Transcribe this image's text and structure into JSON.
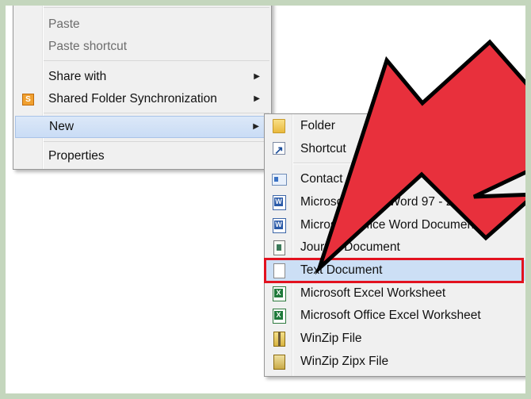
{
  "context_menu": {
    "items": [
      {
        "label": "Paste",
        "disabled": true
      },
      {
        "label": "Paste shortcut",
        "disabled": true
      },
      {
        "label": "Share with",
        "has_submenu": true
      },
      {
        "label": "Shared Folder Synchronization",
        "has_submenu": true,
        "icon": "sync-icon",
        "icon_glyph": "S"
      },
      {
        "label": "New",
        "has_submenu": true,
        "selected": true
      },
      {
        "label": "Properties"
      }
    ]
  },
  "new_submenu": {
    "items": [
      {
        "label": "Folder",
        "icon": "folder-icon"
      },
      {
        "label": "Shortcut",
        "icon": "shortcut-icon"
      },
      {
        "label": "Contact",
        "icon": "contact-icon"
      },
      {
        "label": "Microsoft Office Word 97 - 2003 Document",
        "icon": "word-document-icon"
      },
      {
        "label": "Microsoft Office Word Document",
        "icon": "word-document-icon"
      },
      {
        "label": "Journal Document",
        "icon": "journal-document-icon"
      },
      {
        "label": "Text Document",
        "icon": "text-document-icon",
        "highlighted": true
      },
      {
        "label": "Microsoft Excel Worksheet",
        "icon": "excel-worksheet-icon"
      },
      {
        "label": "Microsoft Office Excel Worksheet",
        "icon": "excel-worksheet-icon"
      },
      {
        "label": "WinZip File",
        "icon": "winzip-icon"
      },
      {
        "label": "WinZip Zipx File",
        "icon": "winzip-zipx-icon"
      }
    ]
  },
  "colors": {
    "annotation_arrow": "#e8303c",
    "highlight_box": "#e2121f",
    "frame": "#c4d6bd",
    "selected_item": "#c9dcf5"
  }
}
